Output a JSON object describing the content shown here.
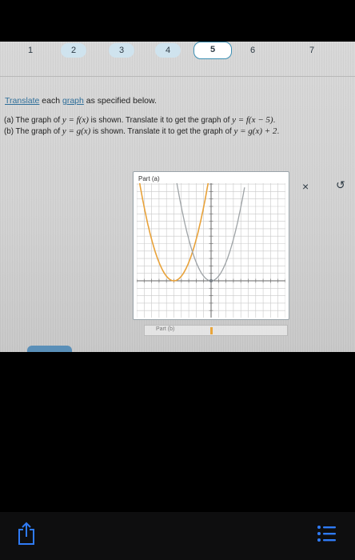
{
  "steps": [
    {
      "label": "1"
    },
    {
      "label": "2"
    },
    {
      "label": "3"
    },
    {
      "label": "4"
    },
    {
      "label": "5",
      "active": true
    },
    {
      "label": "6"
    },
    {
      "label": "7"
    }
  ],
  "instructions": {
    "link1": "Translate",
    "mid": " each ",
    "link2": "graph",
    "end": " as specified below."
  },
  "problems": {
    "a": {
      "label": "(a)",
      "p1": " The graph of ",
      "eq1": "y = f(x)",
      "p2": " is shown. Translate it to get the graph of ",
      "eq2": "y = f(x − 5)",
      "p3": "."
    },
    "b": {
      "label": "(b)",
      "p1": " The graph of ",
      "eq1": "y = g(x)",
      "p2": " is shown. Translate it to get the graph of ",
      "eq2": "y = g(x) + 2",
      "p3": "."
    }
  },
  "panel": {
    "title": "Part (a)",
    "part_b_label": "Part (b)"
  },
  "tools": {
    "clear": "×",
    "undo": "↺"
  },
  "colors": {
    "accent": "#3c8fb3",
    "original_curve": "#e8a23a",
    "translated_curve": "#9ea3a6",
    "toolbar_icon": "#2f7bf6"
  },
  "toolbar": {
    "share_icon": "share-icon",
    "menu_icon": "list-icon"
  }
}
